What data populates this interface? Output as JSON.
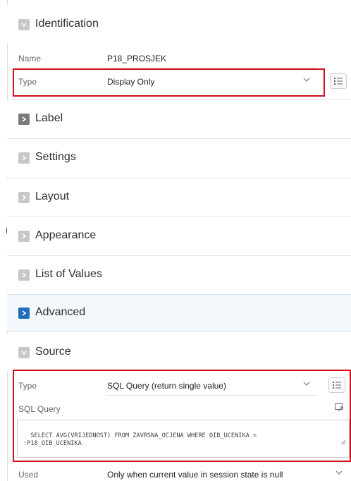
{
  "identification": {
    "title": "Identification",
    "name_label": "Name",
    "name_value": "P18_PROSJEK",
    "type_label": "Type",
    "type_value": "Display Only"
  },
  "sections": [
    {
      "title": "Label"
    },
    {
      "title": "Settings"
    },
    {
      "title": "Layout"
    },
    {
      "title": "Appearance"
    },
    {
      "title": "List of Values"
    },
    {
      "title": "Advanced"
    }
  ],
  "source": {
    "title": "Source",
    "type_label": "Type",
    "type_value": "SQL Query (return single value)",
    "sql_label": "SQL Query",
    "sql_value": "SELECT AVG(VRIJEDNOST) FROM ZAVRSNA_OCJENA WHERE OIB_UCENIKA =\n:P18_OIB_UCENIKA",
    "used_label": "Used",
    "used_value": "Only when current value in session state is null"
  },
  "icons": {
    "collapsed_chevron": "chevron-right-icon",
    "expanded_chevron": "chevron-down-icon",
    "list": "list-icon",
    "expand": "expand-editor-icon",
    "resize": "resize-grip-icon"
  },
  "colors": {
    "highlight_border": "#d0111b",
    "active_chevron": "#1f6fb8"
  }
}
